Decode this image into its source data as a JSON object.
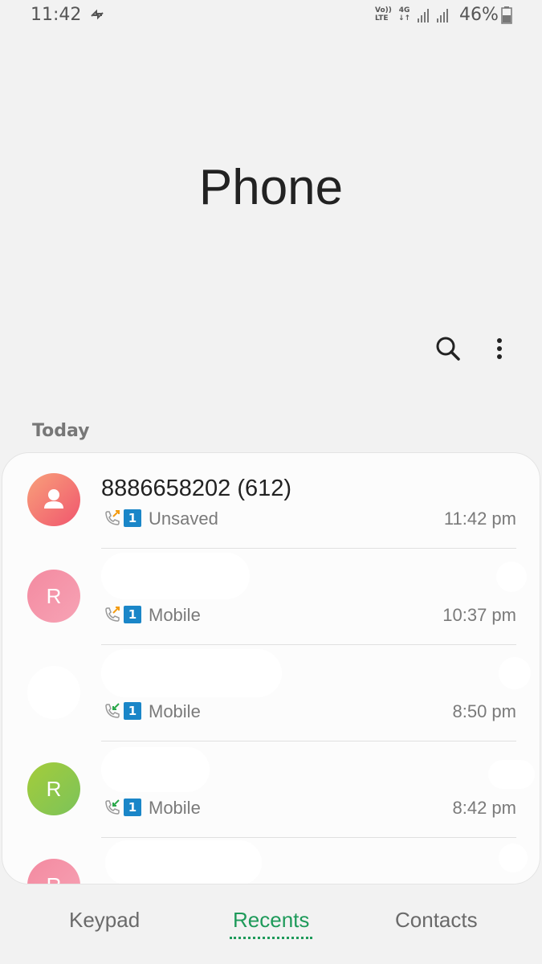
{
  "status_bar": {
    "time": "11:42",
    "volte_line1": "Vo))",
    "volte_line2": "LTE",
    "network": "4G",
    "battery": "46%"
  },
  "title": "Phone",
  "section": "Today",
  "calls": [
    {
      "name": "8886658202 (612)",
      "avatar_letter": "",
      "avatar_kind": "person-icon",
      "direction": "outgoing",
      "sim": "1",
      "label": "Unsaved",
      "time": "11:42 pm",
      "avatar_color": "#f06b7a"
    },
    {
      "name": "",
      "avatar_letter": "R",
      "direction": "outgoing",
      "sim": "1",
      "label": "Mobile",
      "time": "10:37 pm",
      "avatar_color": "#f58fa5"
    },
    {
      "name": "",
      "avatar_letter": "",
      "direction": "incoming",
      "sim": "1",
      "label": "Mobile",
      "time": "8:50 pm",
      "avatar_color": "#ffffff"
    },
    {
      "name": "",
      "avatar_letter": "R",
      "direction": "incoming",
      "sim": "1",
      "label": "Mobile",
      "time": "8:42 pm",
      "avatar_color": "#8bc34a"
    },
    {
      "name": "",
      "avatar_letter": "R",
      "direction": "incoming",
      "sim": "1",
      "label": "",
      "time": "",
      "avatar_color": "#f48aa0"
    }
  ],
  "tabs": {
    "keypad": "Keypad",
    "recents": "Recents",
    "contacts": "Contacts"
  },
  "colors": {
    "accent": "#1e9a5a",
    "sim_badge": "#1a86c8"
  }
}
